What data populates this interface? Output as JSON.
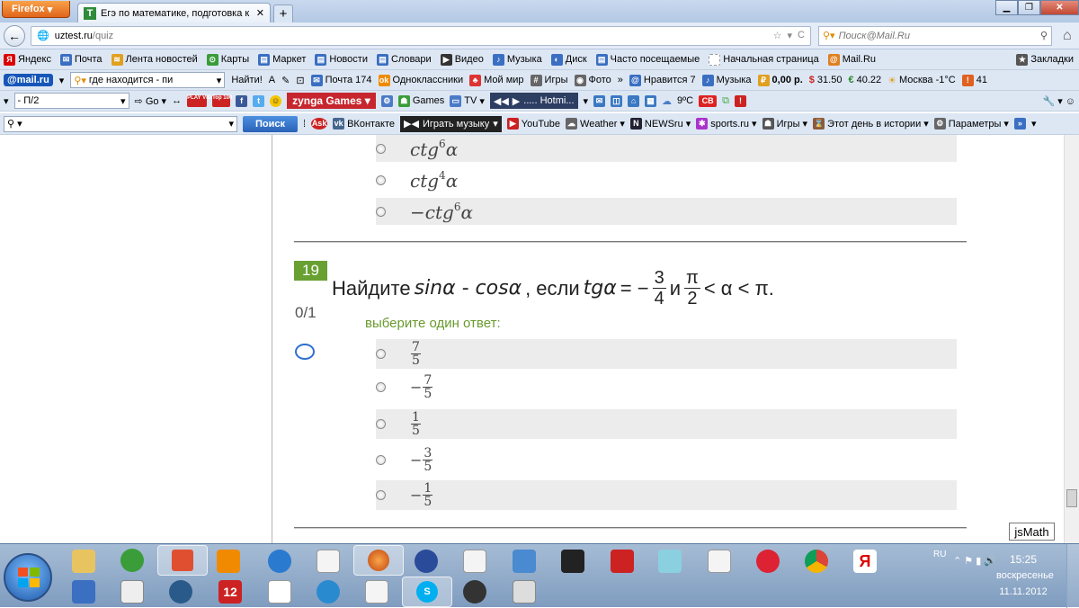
{
  "browser": {
    "name": "Firefox",
    "tab_title": "Егэ по математике, подготовка к тести...",
    "tab_icon": "T",
    "new_tab": "+"
  },
  "nav": {
    "url_host": "uztest.ru",
    "url_path": "/quiz",
    "search_placeholder": "Поиск@Mail.Ru"
  },
  "bookmarks": [
    {
      "label": "Яндекс",
      "color": "#d00"
    },
    {
      "label": "Почта",
      "color": "#3a6fc2"
    },
    {
      "label": "Лента новостей",
      "color": "#e0a020"
    },
    {
      "label": "Карты",
      "color": "#3a9d3a"
    },
    {
      "label": "Маркет",
      "color": "#3a6fc2"
    },
    {
      "label": "Новости",
      "color": "#3a6fc2"
    },
    {
      "label": "Словари",
      "color": "#3a6fc2"
    },
    {
      "label": "Видео",
      "color": "#333"
    },
    {
      "label": "Музыка",
      "color": "#3a6fc2"
    },
    {
      "label": "Диск",
      "color": "#3a6fc2"
    },
    {
      "label": "Часто посещаемые",
      "color": "#3a6fc2"
    },
    {
      "label": "Начальная страница",
      "color": "#999"
    },
    {
      "label": "Mail.Ru",
      "color": "#e08020"
    }
  ],
  "bookmarks_right": "Закладки",
  "mailbar": {
    "logo": "@mail.ru",
    "search_value": "где находится - пи",
    "find": "Найти!",
    "items": [
      "Почта 174",
      "Одноклассники",
      "Мой мир",
      "Игры",
      "Фото",
      "Нравится 7",
      "Музыка",
      "0,00 р.",
      "31.50",
      "40.22",
      "Москва -1°С",
      "41"
    ],
    "more": "»"
  },
  "tb3": {
    "field": "- П/2",
    "go": "Go",
    "zynga": "zynga Games",
    "games": "Games",
    "tv": "TV",
    "hotmail": "..... Hotmi...",
    "temp": "9ºC",
    "top": "Top 100",
    "play": "PLAY VIDS",
    "sv": "СВ"
  },
  "tb4": {
    "search_btn": "Поиск",
    "ask": "Ask",
    "items": [
      "ВКонтакте",
      "Играть музыку",
      "YouTube",
      "Weather",
      "NEWSru",
      "sports.ru",
      "Игры",
      "Этот день в истории",
      "Параметры"
    ],
    "more": "»"
  },
  "quiz": {
    "prev_options": [
      {
        "base": "ctg",
        "exp": "6",
        "var": "α"
      },
      {
        "base": "ctg",
        "exp": "4",
        "var": "α"
      },
      {
        "base": "−ctg",
        "exp": "6",
        "var": "α"
      }
    ],
    "number": "19",
    "q_pre": "Найдите",
    "q_sin": "sinα - cosα",
    "q_mid": ", если",
    "q_tg": "tgα",
    "q_eq": "= −",
    "q_f1n": "3",
    "q_f1d": "4",
    "q_and": "и",
    "q_f2n": "π",
    "q_f2d": "2",
    "q_tail": "< α < π.",
    "grade": "0/1",
    "choose": "выберите один ответ:",
    "options": [
      {
        "sign": "",
        "n": "7",
        "d": "5"
      },
      {
        "sign": "−",
        "n": "7",
        "d": "5"
      },
      {
        "sign": "",
        "n": "1",
        "d": "5"
      },
      {
        "sign": "−",
        "n": "3",
        "d": "5"
      },
      {
        "sign": "−",
        "n": "1",
        "d": "5"
      }
    ],
    "jsmath": "jsMath"
  },
  "taskbar": {
    "lang": "RU",
    "time": "15:25",
    "day": "воскресенье",
    "date": "11.11.2012"
  }
}
